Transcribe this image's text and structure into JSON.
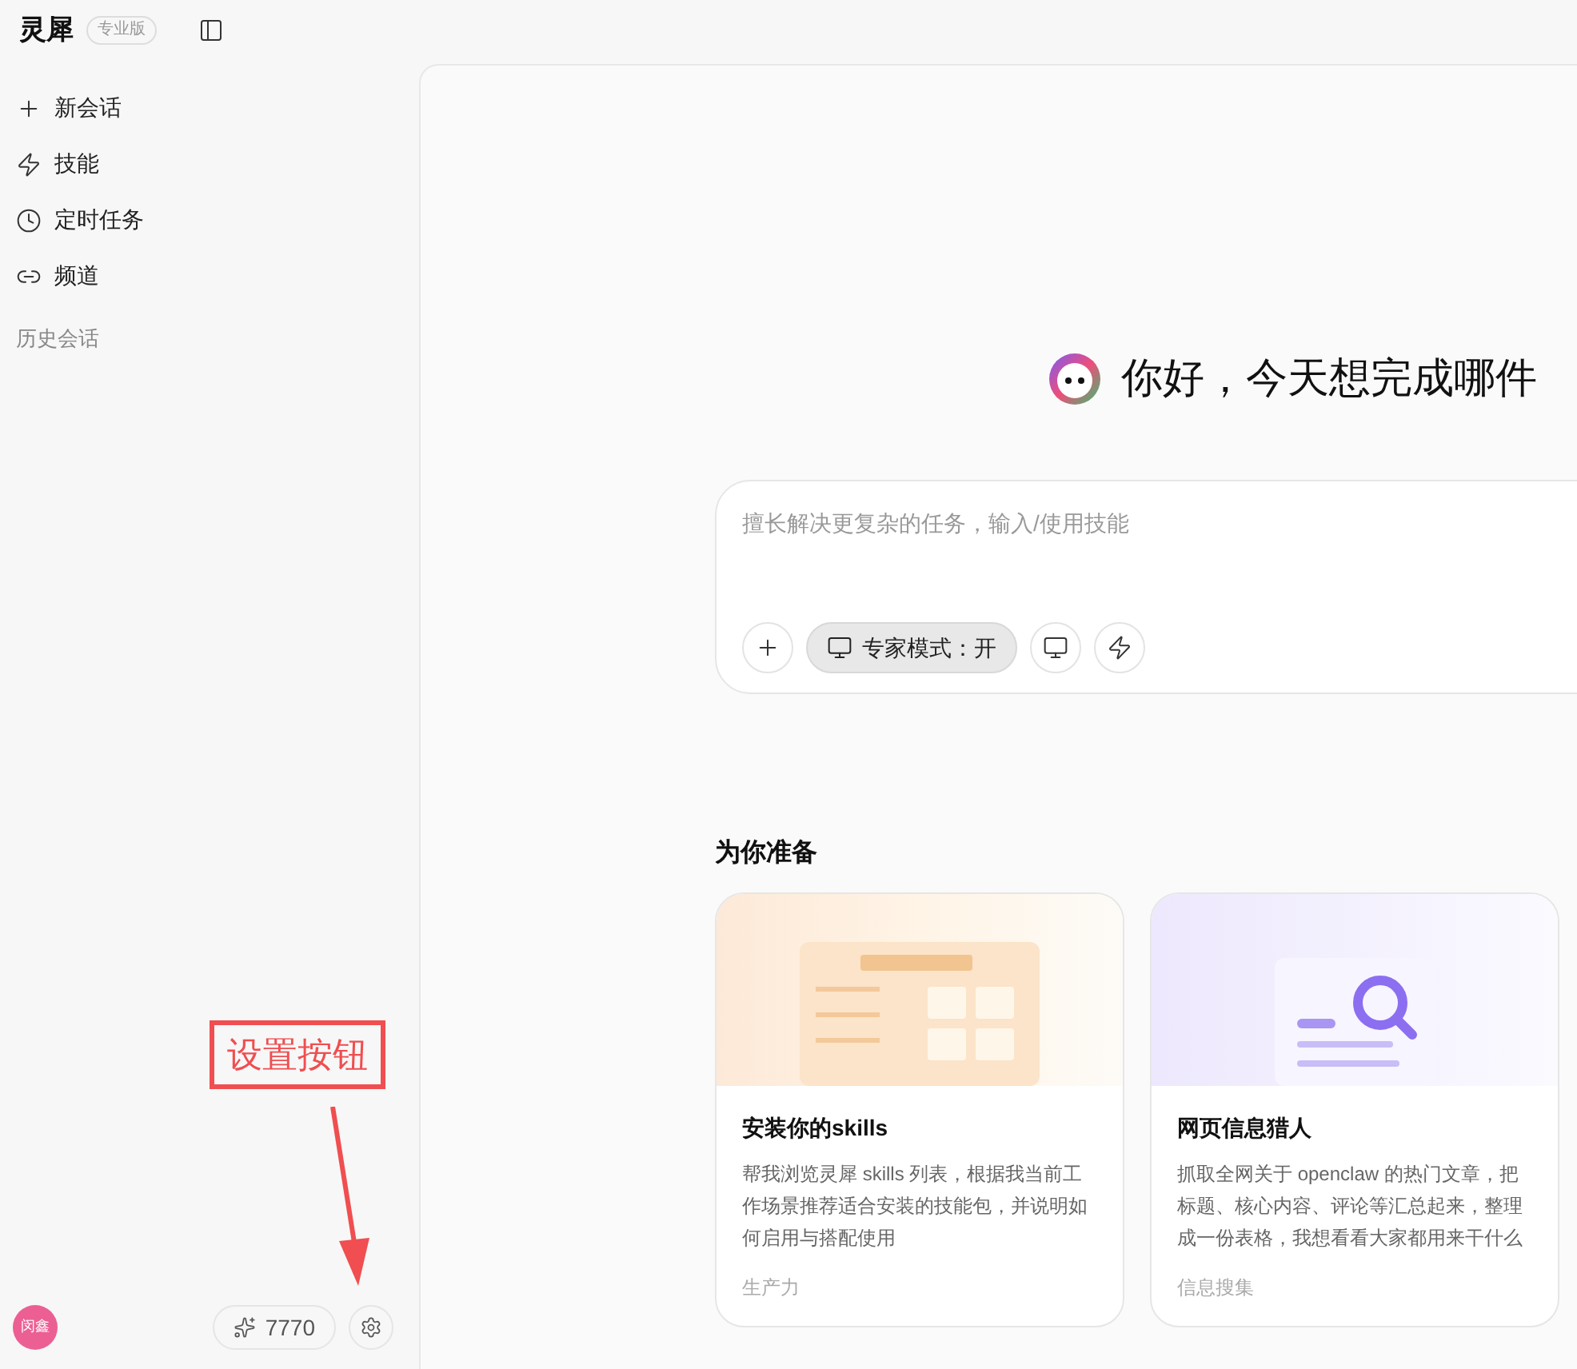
{
  "app": {
    "name": "灵犀",
    "edition": "专业版"
  },
  "nav": [
    {
      "kind": "plus",
      "label": "新会话"
    },
    {
      "kind": "bolt",
      "label": "技能"
    },
    {
      "kind": "clock",
      "label": "定时任务"
    },
    {
      "kind": "channel",
      "label": "频道"
    }
  ],
  "history_heading": "历史会话",
  "user": {
    "avatar_text": "闵鑫",
    "points": "7770"
  },
  "annotation": {
    "label": "设置按钮"
  },
  "greeting": "你好，今天想完成哪件",
  "composer": {
    "placeholder": "擅长解决更复杂的任务，输入/使用技能",
    "mode_button": {
      "label": "专家模式：开",
      "active": true
    }
  },
  "section_title": "为你准备",
  "cards": [
    {
      "kind": "summary",
      "title": "安装你的skills",
      "description": "帮我浏览灵犀 skills 列表，根据我当前工作场景推荐适合安装的技能包，并说明如何启用与搭配使用",
      "tag": "生产力"
    },
    {
      "kind": "search",
      "title": "网页信息猎人",
      "description": "抓取全网关于 openclaw 的热门文章，把标题、核心内容、评论等汇总起来，整理成一份表格，我想看看大家都用来干什么",
      "tag": "信息搜集"
    }
  ]
}
